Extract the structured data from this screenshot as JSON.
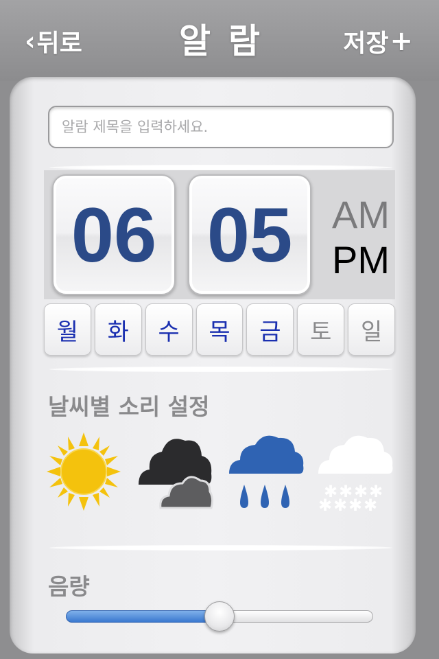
{
  "navbar": {
    "back_label": "뒤로",
    "title": "알람",
    "save_label": "저장"
  },
  "alarm": {
    "title_placeholder": "알람 제목을 입력하세요.",
    "title_value": "",
    "hour": "06",
    "minute": "05",
    "am_label": "AM",
    "pm_label": "PM",
    "period_selected": "PM"
  },
  "days": [
    {
      "label": "월",
      "selected": true
    },
    {
      "label": "화",
      "selected": true
    },
    {
      "label": "수",
      "selected": true
    },
    {
      "label": "목",
      "selected": true
    },
    {
      "label": "금",
      "selected": true
    },
    {
      "label": "토",
      "selected": false
    },
    {
      "label": "일",
      "selected": false
    }
  ],
  "weather": {
    "label": "날씨별 소리 설정",
    "icons": [
      "sun-icon",
      "cloudy-icon",
      "rain-icon",
      "snow-icon"
    ]
  },
  "volume": {
    "label": "음량",
    "level": 0.5
  },
  "colors": {
    "time_digits": "#2b4a88",
    "day_selected": "#1a2fb0",
    "day_unselected": "#8a8a8c",
    "am_inactive": "#7a7a7c",
    "pm_active": "#000000",
    "slider_fill": "#3a78cf",
    "sun": "#f4c20d",
    "rain": "#2f63b3"
  }
}
